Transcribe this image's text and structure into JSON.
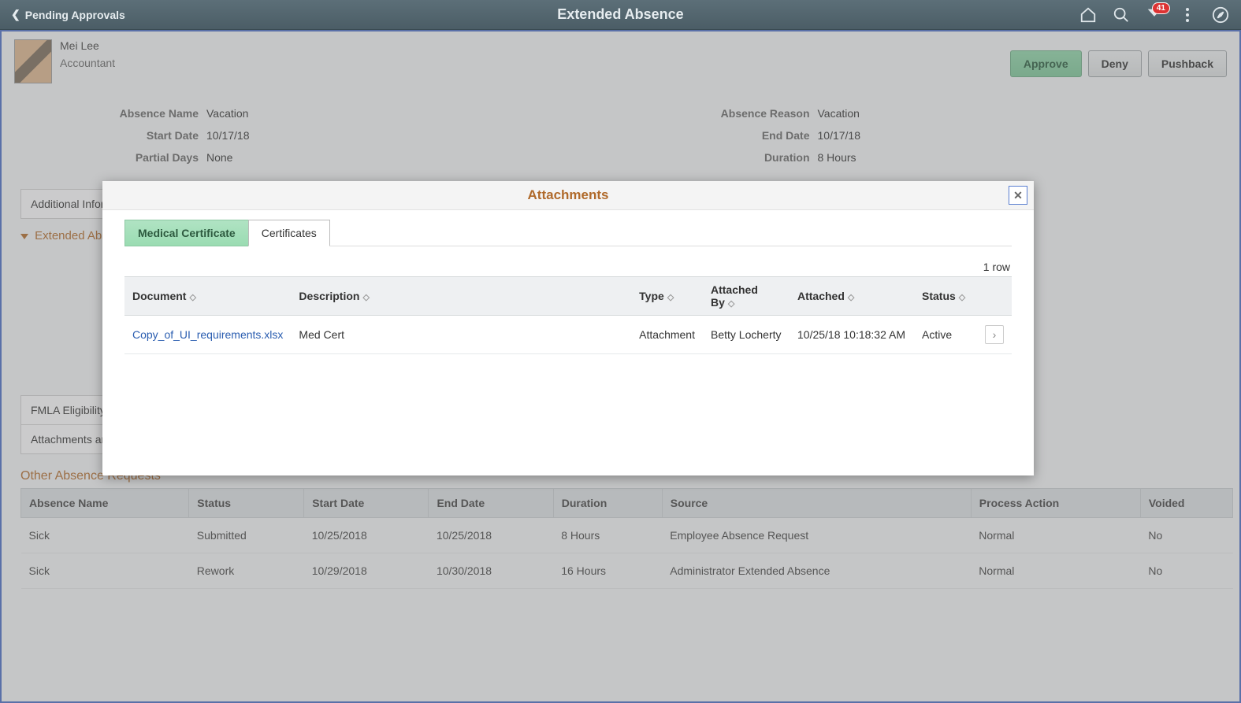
{
  "header": {
    "back_label": "Pending Approvals",
    "page_title": "Extended Absence",
    "notification_count": "41"
  },
  "employee": {
    "name": "Mei Lee",
    "role": "Accountant"
  },
  "actions": {
    "approve": "Approve",
    "deny": "Deny",
    "pushback": "Pushback"
  },
  "details_left": {
    "absence_name_label": "Absence Name",
    "absence_name_value": "Vacation",
    "start_date_label": "Start Date",
    "start_date_value": "10/17/18",
    "partial_days_label": "Partial Days",
    "partial_days_value": "None"
  },
  "details_right": {
    "absence_reason_label": "Absence Reason",
    "absence_reason_value": "Vacation",
    "end_date_label": "End Date",
    "end_date_value": "10/17/18",
    "duration_label": "Duration",
    "duration_value": "8 Hours"
  },
  "panel_rows": {
    "addl_info": "Additional Information",
    "ext_section": "Extended Absence",
    "fmla": "FMLA Eligibility",
    "attachments": "Attachments and Notes"
  },
  "other": {
    "title": "Other Absence Requests",
    "cols": {
      "absence_name": "Absence Name",
      "status": "Status",
      "start_date": "Start Date",
      "end_date": "End Date",
      "duration": "Duration",
      "source": "Source",
      "process_action": "Process Action",
      "voided": "Voided"
    },
    "rows": [
      {
        "absence_name": "Sick",
        "status": "Submitted",
        "start": "10/25/2018",
        "end": "10/25/2018",
        "duration": "8 Hours",
        "source": "Employee Absence Request",
        "pa": "Normal",
        "voided": "No"
      },
      {
        "absence_name": "Sick",
        "status": "Rework",
        "start": "10/29/2018",
        "end": "10/30/2018",
        "duration": "16 Hours",
        "source": "Administrator Extended Absence",
        "pa": "Normal",
        "voided": "No"
      }
    ]
  },
  "modal": {
    "title": "Attachments",
    "tabs": {
      "medcert": "Medical Certificate",
      "certs": "Certificates"
    },
    "rowcount": "1 row",
    "cols": {
      "document": "Document",
      "description": "Description",
      "type": "Type",
      "attached_by": "Attached By",
      "attached": "Attached",
      "status": "Status"
    },
    "row": {
      "document": "Copy_of_UI_requirements.xlsx",
      "description": "Med Cert",
      "type": "Attachment",
      "attached_by": "Betty Locherty",
      "attached": "10/25/18 10:18:32 AM",
      "status": "Active"
    }
  }
}
